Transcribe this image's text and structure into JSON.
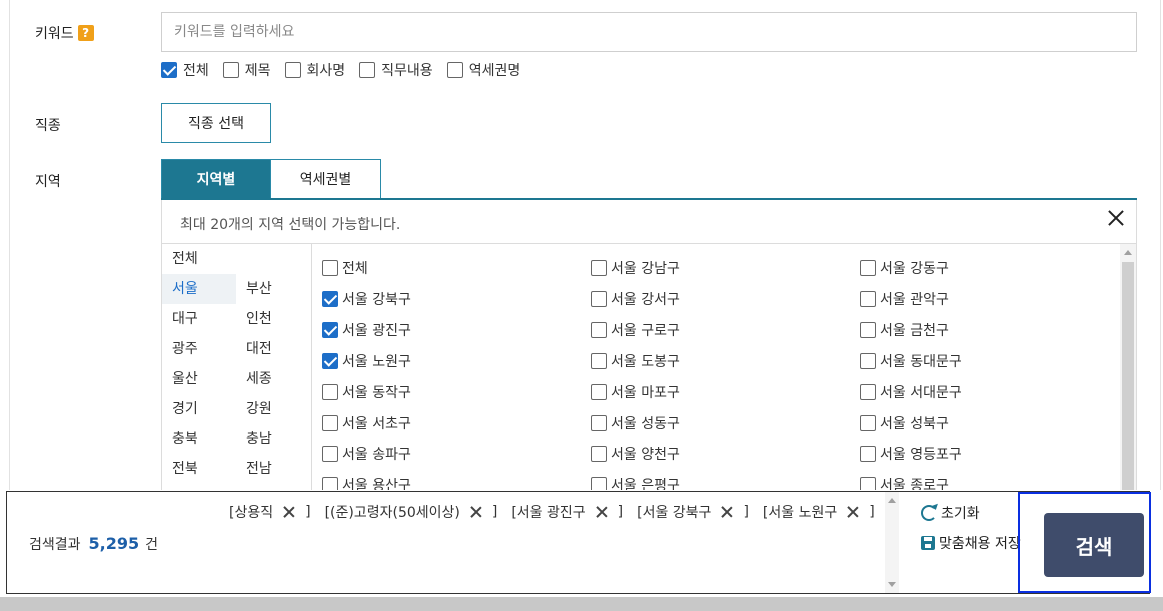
{
  "keyword": {
    "label": "키워드",
    "help_badge": "?",
    "input_value": "",
    "input_placeholder": "키워드를 입력하세요",
    "scopes": [
      {
        "label": "전체",
        "checked": true
      },
      {
        "label": "제목",
        "checked": false
      },
      {
        "label": "회사명",
        "checked": false
      },
      {
        "label": "직무내용",
        "checked": false
      },
      {
        "label": "역세권명",
        "checked": false
      }
    ]
  },
  "job": {
    "label": "직종",
    "button_label": "직종 선택"
  },
  "region": {
    "label": "지역",
    "tabs": [
      {
        "label": "지역별",
        "active": true
      },
      {
        "label": "역세권별",
        "active": false
      }
    ],
    "note": "최대 20개의 지역 선택이 가능합니다.",
    "sido": [
      {
        "label": "전체"
      },
      {
        "label": "서울",
        "selected": true
      },
      {
        "label": "부산"
      },
      {
        "label": "대구"
      },
      {
        "label": "인천"
      },
      {
        "label": "광주"
      },
      {
        "label": "대전"
      },
      {
        "label": "울산"
      },
      {
        "label": "세종"
      },
      {
        "label": "경기"
      },
      {
        "label": "강원"
      },
      {
        "label": "충북"
      },
      {
        "label": "충남"
      },
      {
        "label": "전북"
      },
      {
        "label": "전남"
      }
    ],
    "gu": [
      {
        "label": "전체",
        "checked": false
      },
      {
        "label": "서울 강남구",
        "checked": false
      },
      {
        "label": "서울 강동구",
        "checked": false
      },
      {
        "label": "서울 강북구",
        "checked": true
      },
      {
        "label": "서울 강서구",
        "checked": false
      },
      {
        "label": "서울 관악구",
        "checked": false
      },
      {
        "label": "서울 광진구",
        "checked": true
      },
      {
        "label": "서울 구로구",
        "checked": false
      },
      {
        "label": "서울 금천구",
        "checked": false
      },
      {
        "label": "서울 노원구",
        "checked": true
      },
      {
        "label": "서울 도봉구",
        "checked": false
      },
      {
        "label": "서울 동대문구",
        "checked": false
      },
      {
        "label": "서울 동작구",
        "checked": false
      },
      {
        "label": "서울 마포구",
        "checked": false
      },
      {
        "label": "서울 서대문구",
        "checked": false
      },
      {
        "label": "서울 서초구",
        "checked": false
      },
      {
        "label": "서울 성동구",
        "checked": false
      },
      {
        "label": "서울 성북구",
        "checked": false
      },
      {
        "label": "서울 송파구",
        "checked": false
      },
      {
        "label": "서울 양천구",
        "checked": false
      },
      {
        "label": "서울 영등포구",
        "checked": false
      },
      {
        "label": "서울 용산구",
        "checked": false
      },
      {
        "label": "서울 은평구",
        "checked": false
      },
      {
        "label": "서울 종로구",
        "checked": false
      }
    ]
  },
  "result": {
    "label": "검색결과",
    "count": "5,295",
    "unit": "건"
  },
  "chips": [
    {
      "label": "[상용직"
    },
    {
      "label": "[(준)고령자(50세이상)"
    },
    {
      "label": "[서울 광진구"
    },
    {
      "label": "[서울 강북구"
    },
    {
      "label": "[서울 노원구"
    }
  ],
  "chip_close": "]",
  "actions": {
    "reset_label": "초기화",
    "save_label": "맞춤채용 저장"
  },
  "search_button_label": "검색",
  "colors": {
    "primary": "#1d7791",
    "check": "#1d6ec8",
    "count": "#1d5fa8",
    "search_button": "#3f4c6b",
    "highlight": "#0a2fe0",
    "help_badge": "#f0a019"
  }
}
